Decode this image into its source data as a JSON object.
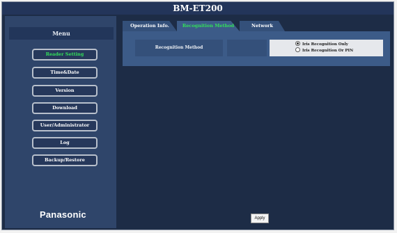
{
  "window": {
    "title": "BM-ET200"
  },
  "sidebar": {
    "menu_title": "Menu",
    "items": [
      {
        "label": "Reader Setting",
        "active": true
      },
      {
        "label": "Time&Date",
        "active": false
      },
      {
        "label": "Version",
        "active": false
      },
      {
        "label": "Download",
        "active": false
      },
      {
        "label": "User/Administrator",
        "active": false
      },
      {
        "label": "Log",
        "active": false
      },
      {
        "label": "Backup/Restore",
        "active": false
      }
    ],
    "brand": "Panasonic"
  },
  "tabs": [
    {
      "label": "Operation Info.",
      "active": false
    },
    {
      "label": "Recognition Method",
      "active": true
    },
    {
      "label": "Network",
      "active": false
    }
  ],
  "settings": {
    "row_label": "Recognition Method",
    "options": [
      {
        "label": "Iris Recognition Only",
        "selected": true
      },
      {
        "label": "Iris Recognition Or PIN",
        "selected": false
      }
    ]
  },
  "footer": {
    "apply_label": "Apply"
  },
  "colors": {
    "background": "#1d2c46",
    "sidebar": "#2f456a",
    "panel": "#3c5b88",
    "active_text": "#33e05a"
  }
}
